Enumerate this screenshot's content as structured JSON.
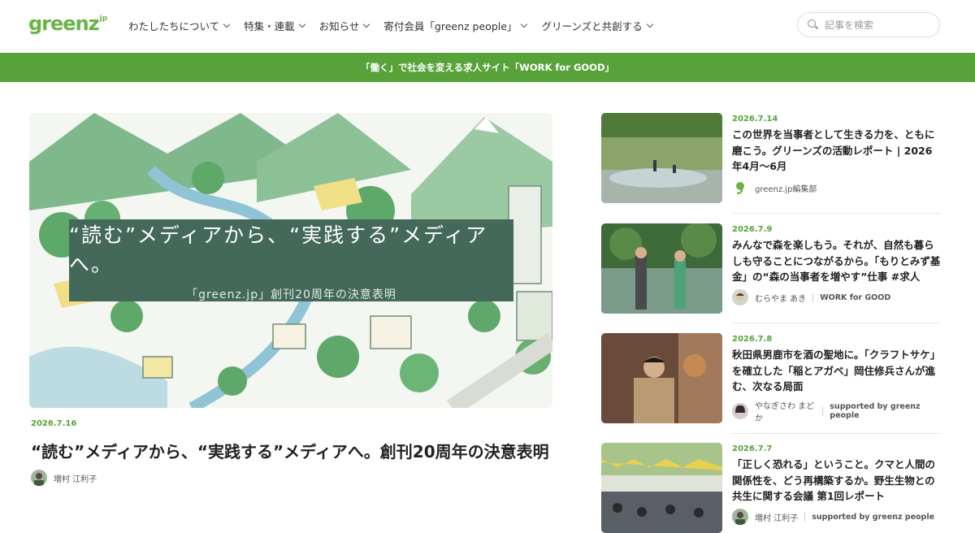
{
  "header": {
    "logo_text": "greenz",
    "logo_suffix": "jp",
    "nav": [
      {
        "label": "わたしたちについて"
      },
      {
        "label": "特集・連載"
      },
      {
        "label": "お知らせ"
      },
      {
        "label": "寄付会員「greenz people」"
      },
      {
        "label": "グリーンズと共創する"
      }
    ],
    "search_placeholder": "記事を検索"
  },
  "banner": {
    "text": "「働く」で社会を変える求人サイト「WORK for GOOD」"
  },
  "featured": {
    "overlay_title": "“読む”メディアから、“実践する”メディアへ。",
    "overlay_subtitle": "「greenz.jp」創刊20周年の決意表明",
    "date": "2026.7.16",
    "title": "“読む”メディアから、“実践する”メディアへ。創刊20周年の決意表明",
    "author": "増村 江利子"
  },
  "articles": [
    {
      "date": "2026.7.14",
      "title": "この世界を当事者として生きる力を、ともに磨こう。グリーンズの活動レポート | 2026年4月〜6月",
      "author": "greenz.jp編集部",
      "tag": ""
    },
    {
      "date": "2026.7.9",
      "title": "みんなで森を楽しもう。それが、自然も暮らしも守ることにつながるから。「もりとみず基金」の“森の当事者を増やす”仕事 #求人",
      "author": "むらやま あき",
      "tag": "WORK for GOOD"
    },
    {
      "date": "2026.7.8",
      "title": "秋田県男鹿市を酒の聖地に。「クラフトサケ」を確立した「稲とアガベ」岡住修兵さんが進む、次なる局面",
      "author": "やなぎさわ まどか",
      "tag": "supported by greenz people"
    },
    {
      "date": "2026.7.7",
      "title": "「正しく恐れる」ということ。クマと人間の関係性を、どう再構築するか。野生生物との共生に関する会議 第1回レポート",
      "author": "増村 江利子",
      "tag": "supported by greenz people"
    }
  ],
  "colors": {
    "brand_green": "#58a23a",
    "overlay": "#44695a"
  }
}
